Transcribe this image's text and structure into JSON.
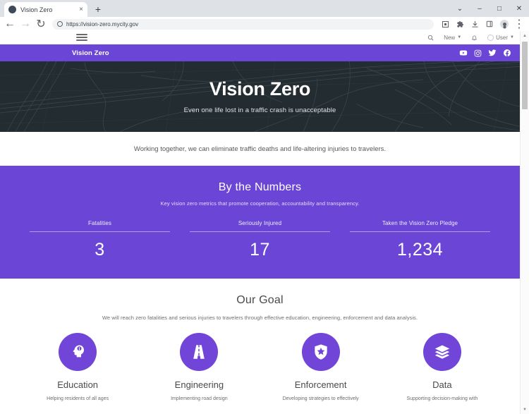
{
  "browser": {
    "tab": {
      "title": "Vision Zero",
      "close_label": "×",
      "favicon": "globe-icon"
    },
    "new_tab_label": "+",
    "window_controls": {
      "collapse": "⌄",
      "minimize": "–",
      "maximize": "□",
      "close": "✕"
    },
    "nav": {
      "back": "←",
      "forward": "→",
      "reload": "↻",
      "menu": "⋮"
    },
    "url": "https://vision-zero.mycity.gov"
  },
  "site_toolbar": {
    "menu_icon": "hamburger-icon",
    "search_icon": "search-icon",
    "new_label": "New",
    "notifications_icon": "bell-icon",
    "user_label": "User"
  },
  "site_header": {
    "brand": "Vision Zero",
    "social": [
      "youtube",
      "instagram",
      "twitter",
      "facebook"
    ]
  },
  "hero": {
    "title": "Vision Zero",
    "subtitle": "Even one life lost in a traffic crash is unacceptable"
  },
  "intro": {
    "text": "Working together, we can eliminate traffic deaths and life-altering injuries to travelers."
  },
  "numbers": {
    "title": "By the Numbers",
    "subtitle": "Key vision zero metrics that promote cooperation, accountability and transparency.",
    "stats": [
      {
        "label": "Fatalities",
        "value": "3"
      },
      {
        "label": "Seriously Injured",
        "value": "17"
      },
      {
        "label": "Taken the Vision Zero Pledge",
        "value": "1,234"
      }
    ]
  },
  "goal": {
    "title": "Our Goal",
    "subtitle": "We will reach zero fatalities and serious injuries to travelers through effective education, engineering, enforcement and data analysis.",
    "pillars": [
      {
        "name": "Education",
        "icon": "head-info-icon",
        "desc": "Helping residents of all ages"
      },
      {
        "name": "Engineering",
        "icon": "road-icon",
        "desc": "Implementing road design"
      },
      {
        "name": "Enforcement",
        "icon": "shield-star-icon",
        "desc": "Developing strategies to effectively"
      },
      {
        "name": "Data",
        "icon": "layers-icon",
        "desc": "Supporting decision-making with"
      }
    ]
  },
  "colors": {
    "brand_purple": "#6b46d6",
    "icon_purple": "#7145d8",
    "hero_dark": "#232c30"
  }
}
